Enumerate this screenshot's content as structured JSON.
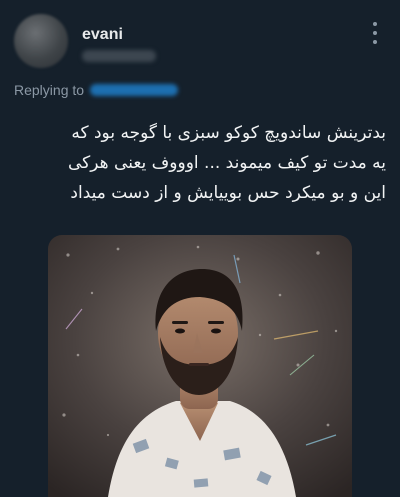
{
  "tweet": {
    "author": {
      "display_name": "evani",
      "avatar_icon": "blurred-avatar-icon",
      "handle_icon": "blurred-handle"
    },
    "more_icon": "more-options-icon",
    "reply": {
      "label": "Replying to",
      "mention_icon": "blurred-mention"
    },
    "text_lines": [
      "بدترینش ساندویچ کوکو سبزی با گوجه بود که",
      "یه مدت تو کیف میموند ... اوووف یعنی هرکی",
      "این و بو میکرد حس بوییایش و از دست میداد"
    ],
    "media": {
      "type": "image",
      "colors": {
        "background": "#15202b",
        "accent": "#1d9bf0"
      }
    }
  }
}
